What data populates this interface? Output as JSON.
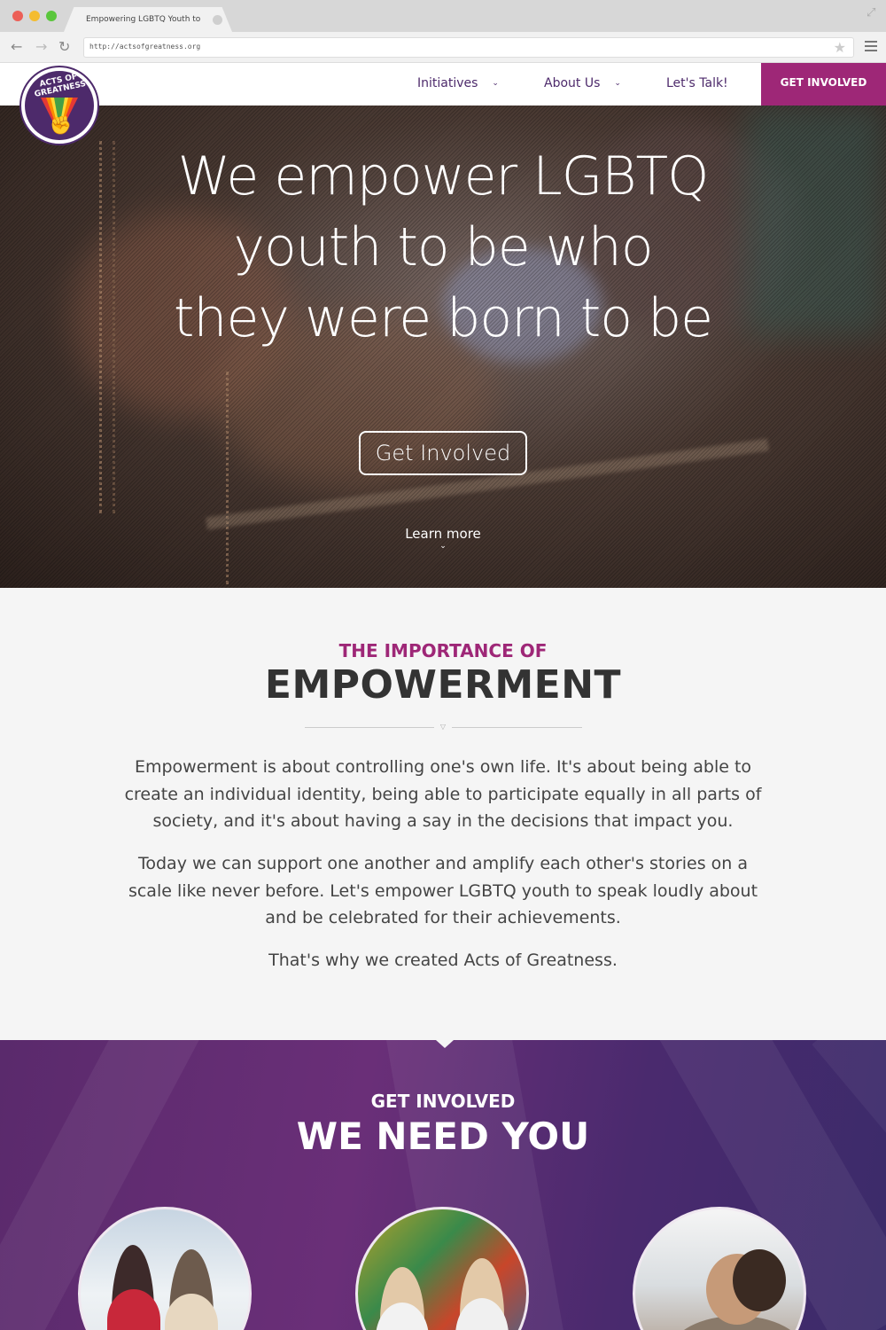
{
  "browser": {
    "tab_title": "Empowering LGBTQ Youth to",
    "url": "http://actsofgreatness.org",
    "dot_colors": [
      "#ec5f57",
      "#f4bc2f",
      "#5ac63c"
    ]
  },
  "header": {
    "logo_text": "Acts of Greatness",
    "nav": {
      "initiatives": "Initiatives",
      "about": "About Us",
      "talk": "Let's Talk!",
      "cta": "GET INVOLVED"
    }
  },
  "hero": {
    "title_lines": [
      "We empower LGBTQ",
      "youth to be who",
      "they were born to be"
    ],
    "button": "Get Involved",
    "learn_more": "Learn more"
  },
  "importance": {
    "eyebrow": "THE IMPORTANCE OF",
    "heading": "EMPOWERMENT",
    "paragraphs": [
      "Empowerment is about controlling one's own life. It's about being able to create an individual identity, being able to participate equally in all parts of society, and it's about having a say in the decisions that impact you.",
      "Today we can support one another and amplify each other's stories on a scale like never before. Let's empower LGBTQ youth to speak loudly about and be celebrated for their achievements.",
      "That's why we created Acts of Greatness."
    ]
  },
  "involved": {
    "eyebrow": "GET INVOLVED",
    "heading": "WE NEED YOU"
  },
  "colors": {
    "brand_purple": "#4d2a6b",
    "brand_magenta": "#9e2777",
    "section_bg": "#f5f5f5"
  }
}
